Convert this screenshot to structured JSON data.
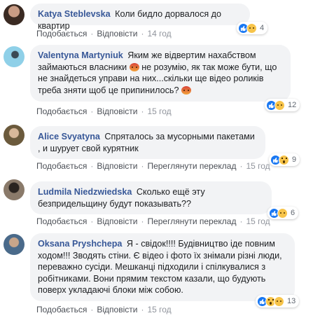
{
  "comments": [
    {
      "author": "Katya Steblevska",
      "text": "Коли бидло дорвалося до квартир",
      "like_label": "Подобається",
      "reply_label": "Відповісти",
      "time": "14 год",
      "reaction_count": "4",
      "reactions": [
        "like",
        "sad"
      ]
    },
    {
      "author": "Valentyna Martyniuk",
      "text_1": "Яким же відвертим нахабством займаються власники",
      "text_2": "не розумію, як так може бути, що не знайдеться управи на них...скільки ще відео роликів треба зняти щоб це припинилось?",
      "like_label": "Подобається",
      "reply_label": "Відповісти",
      "time": "15 год",
      "reaction_count": "12",
      "reactions": [
        "like",
        "sad"
      ],
      "inline_emoji": "angry-face-emoji"
    },
    {
      "author": "Alice Svyatyna",
      "text": "Спряталось за мусорными пакетами , и шурует свой курятник",
      "like_label": "Подобається",
      "reply_label": "Відповісти",
      "translate_label": "Переглянути переклад",
      "time": "15 год",
      "reaction_count": "9",
      "reactions": [
        "like",
        "wow"
      ]
    },
    {
      "author": "Ludmila Niedzwiedska",
      "text": "Сколько ещё эту безпридельщину будут показывать??",
      "like_label": "Подобається",
      "reply_label": "Відповісти",
      "translate_label": "Переглянути переклад",
      "time": "15 год",
      "reaction_count": "6",
      "reactions": [
        "like",
        "sad"
      ]
    },
    {
      "author": "Oksana Pryshchepa",
      "text": "Я - свідок!!!! Будівництво іде повним ходом!!! Зводять стіни. Є відео і фото їх знімали різні люди, переважно сусіди. Мешканці підходили і спілкувалися з робітниками. Вони прямим текстом казали, що будують поверх укладаючі блоки між собою.",
      "like_label": "Подобається",
      "reply_label": "Відповісти",
      "time": "15 год",
      "reaction_count": "13",
      "reactions": [
        "like",
        "wow",
        "sad"
      ]
    }
  ],
  "colors": {
    "bubble": "#f2f3f5",
    "author": "#385898",
    "like_blue": "#1877f2",
    "emoji_yellow": "#f7c44a",
    "meta_gray": "#90949c"
  }
}
